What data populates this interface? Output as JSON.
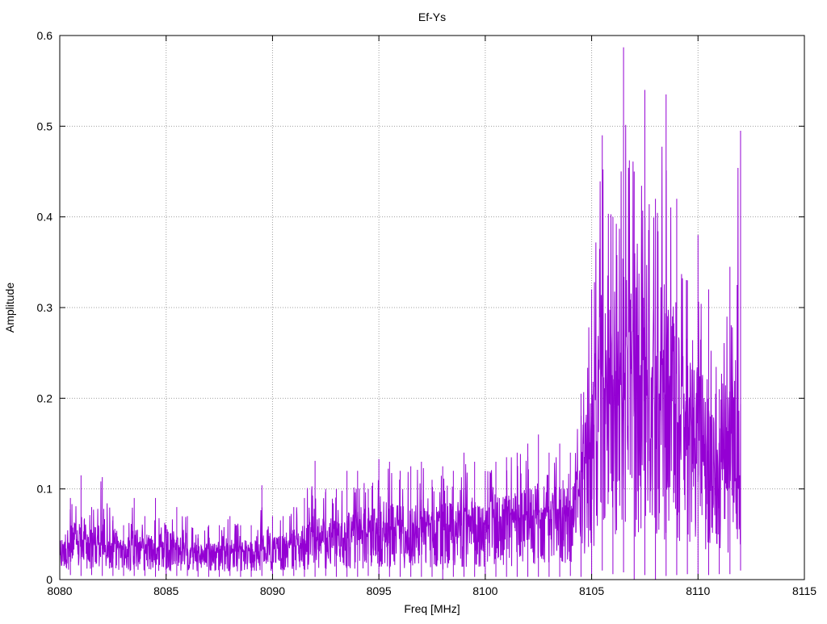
{
  "chart_data": {
    "type": "line",
    "title": "Ef-Ys",
    "xlabel": "Freq [MHz]",
    "ylabel": "Amplitude",
    "xlim": [
      8080,
      8115
    ],
    "ylim": [
      0,
      0.6
    ],
    "xticks": [
      8080,
      8085,
      8090,
      8095,
      8100,
      8105,
      8110,
      8115
    ],
    "yticks": [
      0,
      0.1,
      0.2,
      0.3,
      0.4,
      0.5,
      0.6
    ],
    "xtick_labels": [
      "8080",
      "8085",
      "8090",
      "8095",
      "8100",
      "8105",
      "8110",
      "8115"
    ],
    "ytick_labels": [
      "0",
      "0.1",
      "0.2",
      "0.3",
      "0.4",
      "0.5",
      "0.6"
    ],
    "grid": true,
    "series": [
      {
        "color": "#9400d3",
        "x": [
          8080.0,
          8080.5,
          8081.0,
          8081.5,
          8082.0,
          8082.5,
          8083.0,
          8083.5,
          8084.0,
          8084.5,
          8085.0,
          8085.5,
          8086.0,
          8086.5,
          8087.0,
          8087.5,
          8088.0,
          8088.5,
          8089.0,
          8089.5,
          8090.0,
          8090.5,
          8091.0,
          8091.5,
          8092.0,
          8092.5,
          8093.0,
          8093.5,
          8094.0,
          8094.5,
          8095.0,
          8095.5,
          8096.0,
          8096.5,
          8097.0,
          8097.5,
          8098.0,
          8098.5,
          8099.0,
          8099.5,
          8100.0,
          8100.5,
          8101.0,
          8101.5,
          8102.0,
          8102.5,
          8103.0,
          8103.5,
          8104.0,
          8104.5,
          8105.0,
          8105.5,
          8106.0,
          8106.5,
          8107.0,
          8107.5,
          8108.0,
          8108.5,
          8109.0,
          8109.5,
          8110.0,
          8110.5,
          8111.0,
          8111.5,
          8112.0
        ],
        "max": [
          0.06,
          0.09,
          0.115,
          0.08,
          0.113,
          0.07,
          0.06,
          0.09,
          0.07,
          0.09,
          0.06,
          0.08,
          0.07,
          0.05,
          0.06,
          0.06,
          0.07,
          0.06,
          0.06,
          0.104,
          0.07,
          0.07,
          0.08,
          0.09,
          0.131,
          0.1,
          0.1,
          0.12,
          0.12,
          0.1,
          0.133,
          0.13,
          0.12,
          0.125,
          0.13,
          0.11,
          0.125,
          0.12,
          0.14,
          0.13,
          0.12,
          0.13,
          0.135,
          0.14,
          0.15,
          0.16,
          0.14,
          0.15,
          0.14,
          0.205,
          0.32,
          0.49,
          0.4,
          0.587,
          0.45,
          0.54,
          0.42,
          0.535,
          0.42,
          0.33,
          0.38,
          0.32,
          0.21,
          0.345,
          0.495
        ],
        "avg": [
          0.03,
          0.035,
          0.04,
          0.035,
          0.038,
          0.035,
          0.032,
          0.036,
          0.033,
          0.035,
          0.03,
          0.032,
          0.03,
          0.028,
          0.028,
          0.03,
          0.031,
          0.03,
          0.03,
          0.034,
          0.032,
          0.034,
          0.036,
          0.038,
          0.042,
          0.04,
          0.042,
          0.044,
          0.046,
          0.046,
          0.05,
          0.05,
          0.05,
          0.052,
          0.055,
          0.052,
          0.054,
          0.055,
          0.058,
          0.056,
          0.056,
          0.058,
          0.06,
          0.062,
          0.064,
          0.066,
          0.066,
          0.068,
          0.07,
          0.09,
          0.15,
          0.2,
          0.19,
          0.23,
          0.22,
          0.22,
          0.2,
          0.2,
          0.18,
          0.16,
          0.15,
          0.14,
          0.12,
          0.11,
          0.1
        ],
        "min": [
          0.005,
          0.005,
          0.004,
          0.005,
          0.004,
          0.004,
          0.004,
          0.004,
          0.004,
          0.003,
          0.004,
          0.004,
          0.004,
          0.003,
          0.003,
          0.003,
          0.004,
          0.003,
          0.003,
          0.004,
          0.004,
          0.004,
          0.004,
          0.003,
          0.003,
          0.004,
          0.003,
          0.003,
          0.003,
          0.004,
          0.003,
          0.003,
          0.003,
          0.003,
          0.003,
          0.003,
          0.0,
          0.003,
          0.003,
          0.003,
          0.003,
          0.003,
          0.003,
          0.003,
          0.003,
          0.003,
          0.003,
          0.003,
          0.004,
          0.003,
          0.005,
          0.01,
          0.006,
          0.008,
          0.0,
          0.005,
          0.0,
          0.004,
          0.005,
          0.006,
          0.006,
          0.005,
          0.006,
          0.006,
          0.01
        ]
      }
    ]
  }
}
